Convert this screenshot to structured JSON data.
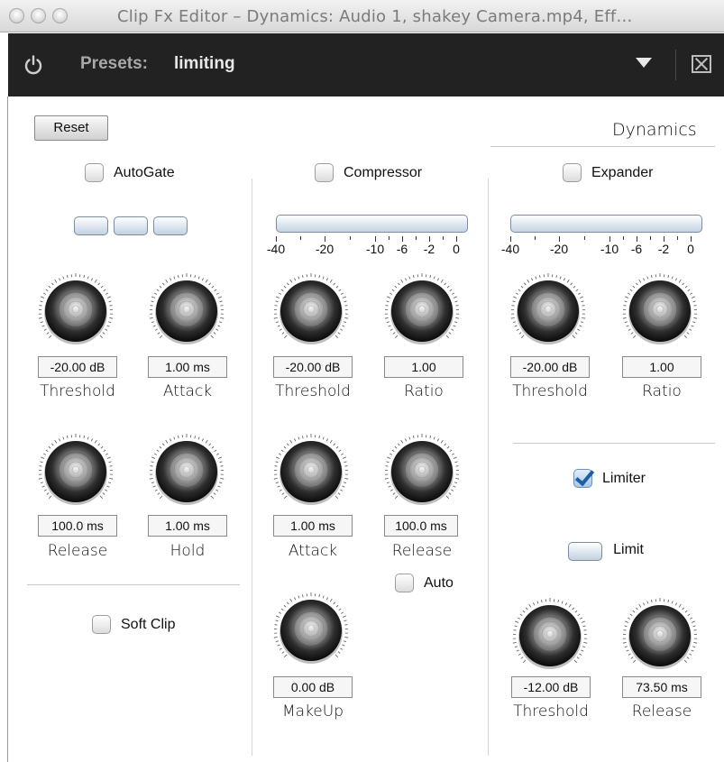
{
  "window": {
    "title": "Clip Fx Editor – Dynamics: Audio 1, shakey Camera.mp4, Eff…"
  },
  "toolbar": {
    "presets_label": "Presets:",
    "preset_value": "limiting"
  },
  "panel": {
    "title": "Dynamics",
    "reset_label": "Reset"
  },
  "autogate": {
    "label": "AutoGate",
    "checked": false,
    "threshold": {
      "value": "-20.00 dB",
      "label": "Threshold"
    },
    "attack": {
      "value": "1.00 ms",
      "label": "Attack"
    },
    "release": {
      "value": "100.0 ms",
      "label": "Release"
    },
    "hold": {
      "value": "1.00 ms",
      "label": "Hold"
    }
  },
  "softclip": {
    "label": "Soft Clip",
    "checked": false
  },
  "compressor": {
    "label": "Compressor",
    "checked": false,
    "scale": [
      "-40",
      "-20",
      "-10",
      "-6",
      "-2",
      "0"
    ],
    "threshold": {
      "value": "-20.00 dB",
      "label": "Threshold"
    },
    "ratio": {
      "value": "1.00",
      "label": "Ratio"
    },
    "attack": {
      "value": "1.00 ms",
      "label": "Attack"
    },
    "release": {
      "value": "100.0 ms",
      "label": "Release"
    },
    "auto": {
      "label": "Auto",
      "checked": false
    },
    "makeup": {
      "value": "0.00 dB",
      "label": "MakeUp"
    }
  },
  "expander": {
    "label": "Expander",
    "checked": false,
    "scale": [
      "-40",
      "-20",
      "-10",
      "-6",
      "-2",
      "0"
    ],
    "threshold": {
      "value": "-20.00 dB",
      "label": "Threshold"
    },
    "ratio": {
      "value": "1.00",
      "label": "Ratio"
    }
  },
  "limiter": {
    "label": "Limiter",
    "checked": true,
    "limit_label": "Limit",
    "threshold": {
      "value": "-12.00 dB",
      "label": "Threshold"
    },
    "release": {
      "value": "73.50 ms",
      "label": "Release"
    }
  },
  "colors": {
    "toolbar_bg": "#222222",
    "check_blue": "#1b5fa6"
  }
}
